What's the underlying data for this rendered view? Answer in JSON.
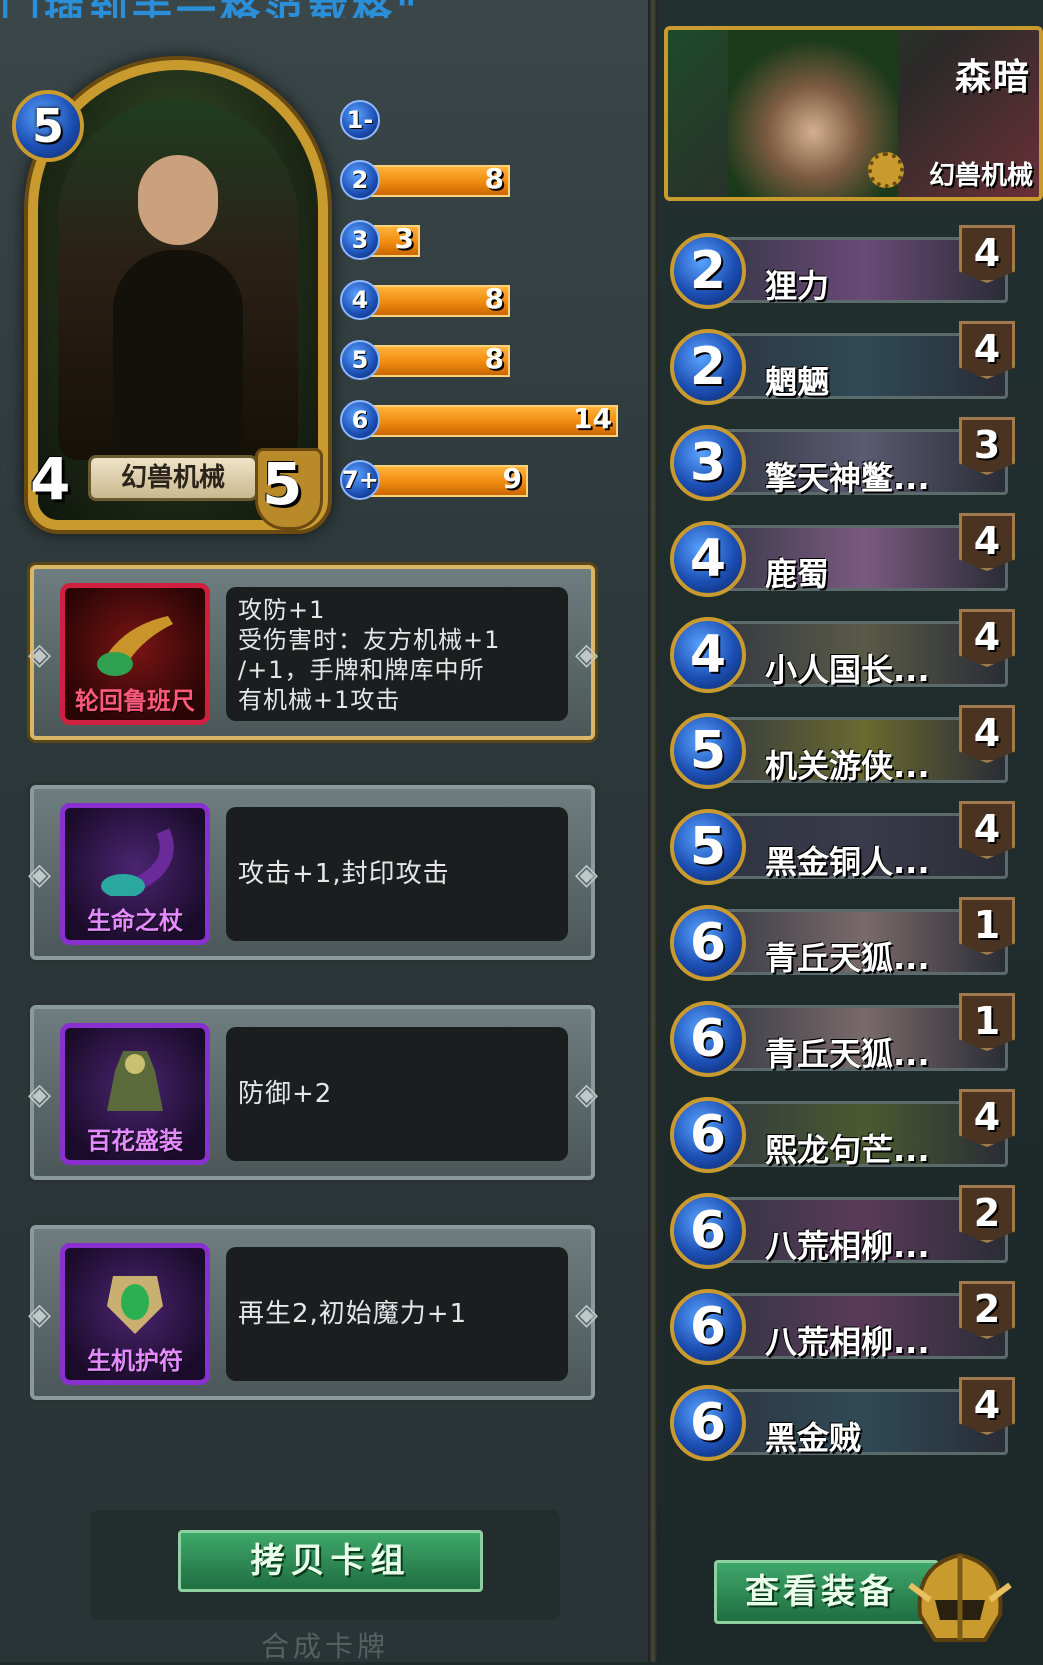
{
  "top_title": "门插到手一格范载格\"",
  "hero": {
    "cost": "5",
    "attack": "4",
    "health": "5",
    "tribe": "幻兽机械"
  },
  "mana_curve": [
    {
      "cost": "1-",
      "count": "",
      "value": 0
    },
    {
      "cost": "2",
      "count": "8",
      "value": 8
    },
    {
      "cost": "3",
      "count": "3",
      "value": 3
    },
    {
      "cost": "4",
      "count": "8",
      "value": 8
    },
    {
      "cost": "5",
      "count": "8",
      "value": 8
    },
    {
      "cost": "6",
      "count": "14",
      "value": 14
    },
    {
      "cost": "7+",
      "count": "9",
      "value": 9
    }
  ],
  "equipment": [
    {
      "name": "轮回鲁班尺",
      "description": "攻防+1\n受伤害时：友方机械+1\n/+1，手牌和牌库中所\n有机械+1攻击",
      "rarity": "red",
      "icon": "horn-icon"
    },
    {
      "name": "生命之杖",
      "description": "攻击+1,封印攻击",
      "rarity": "purple",
      "icon": "staff-icon"
    },
    {
      "name": "百花盛装",
      "description": "防御+2",
      "rarity": "purple",
      "icon": "armor-icon"
    },
    {
      "name": "生机护符",
      "description": "再生2,初始魔力+1",
      "rarity": "purple",
      "icon": "amulet-icon"
    }
  ],
  "copy_deck_label": "拷贝卡组",
  "compose_label": "合成卡牌",
  "deck_header": {
    "hero_name": "森暗",
    "tribe": "幻兽机械"
  },
  "deck_cards": [
    {
      "cost": "2",
      "name": "狸力",
      "count": "4",
      "color": "#6b4a78"
    },
    {
      "cost": "2",
      "name": "魍魉",
      "count": "4",
      "color": "#2f4a56"
    },
    {
      "cost": "3",
      "name": "擎天神鳖...",
      "count": "3",
      "color": "#5a5a70"
    },
    {
      "cost": "4",
      "name": "鹿蜀",
      "count": "4",
      "color": "#7a5a80"
    },
    {
      "cost": "4",
      "name": "小人国长...",
      "count": "4",
      "color": "#5a5a48"
    },
    {
      "cost": "5",
      "name": "机关游侠...",
      "count": "4",
      "color": "#6a6a30"
    },
    {
      "cost": "5",
      "name": "黑金铜人...",
      "count": "4",
      "color": "#3a3a4a"
    },
    {
      "cost": "6",
      "name": "青丘天狐...",
      "count": "1",
      "color": "#7a6a6a"
    },
    {
      "cost": "6",
      "name": "青丘天狐...",
      "count": "1",
      "color": "#7a6a6a"
    },
    {
      "cost": "6",
      "name": "熙龙句芒...",
      "count": "4",
      "color": "#4a5a30"
    },
    {
      "cost": "6",
      "name": "八荒相柳...",
      "count": "2",
      "color": "#5a3a5a"
    },
    {
      "cost": "6",
      "name": "八荒相柳...",
      "count": "2",
      "color": "#5a3a5a"
    },
    {
      "cost": "6",
      "name": "黑金贼",
      "count": "4",
      "color": "#2f4a56"
    }
  ],
  "view_equipment_label": "查看装备"
}
